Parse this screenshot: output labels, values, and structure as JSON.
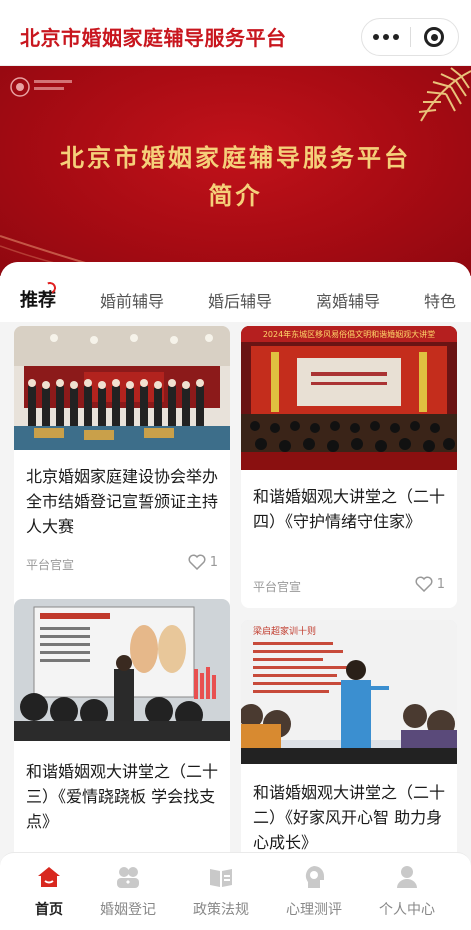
{
  "header": {
    "title": "北京市婚姻家庭辅导服务平台"
  },
  "banner": {
    "title": "北京市婚姻家庭辅导服务平台",
    "subtitle": "简介"
  },
  "tabs": [
    {
      "label": "推荐",
      "active": true
    },
    {
      "label": "婚前辅导"
    },
    {
      "label": "婚后辅导"
    },
    {
      "label": "离婚辅导"
    },
    {
      "label": "特色"
    }
  ],
  "cards": [
    {
      "title": "北京婚姻家庭建设协会举办全市结婚登记宣誓颁证主持人大赛",
      "source": "平台官宣",
      "likes": "1",
      "image": "ceremony-group-photo"
    },
    {
      "title": "和谐婚姻观大讲堂之（二十四）《守护情绪守住家》",
      "source": "平台官宣",
      "likes": "1",
      "image": "lecture-hall-photo",
      "image_caption": "2024年东城区移风易俗倡文明和谐婚姻观大讲堂"
    },
    {
      "title": "和谐婚姻观大讲堂之（二十三）《爱情跷跷板 学会找支点》",
      "source": "",
      "likes": "",
      "image": "presentation-photo"
    },
    {
      "title": "和谐婚姻观大讲堂之（二十二）《好家风开心智 助力身心成长》",
      "source": "",
      "likes": "",
      "image": "speaker-photo",
      "image_caption": "梁启超家训十则"
    }
  ],
  "nav": [
    {
      "label": "首页",
      "icon": "home-icon",
      "active": true
    },
    {
      "label": "婚姻登记",
      "icon": "couple-icon"
    },
    {
      "label": "政策法规",
      "icon": "book-icon"
    },
    {
      "label": "心理测评",
      "icon": "head-icon"
    },
    {
      "label": "个人中心",
      "icon": "person-icon"
    }
  ],
  "colors": {
    "brand": "#c8161e",
    "gold": "#f5d07a"
  }
}
